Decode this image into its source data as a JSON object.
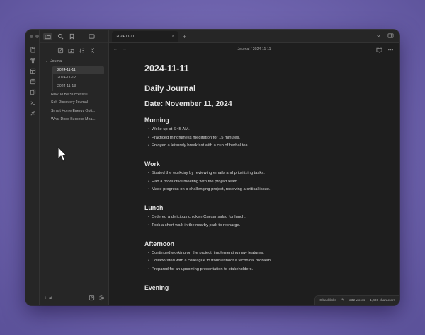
{
  "app": {
    "ribbon_icons": [
      "files-icon",
      "graph-icon",
      "canvas-icon",
      "calendar-icon",
      "templates-icon",
      "terminal-icon",
      "publish-icon"
    ],
    "sidebar_top_icons": [
      "folder-icon",
      "search-icon",
      "bookmark-icon"
    ],
    "sidebar_actions": [
      "new-note-icon",
      "new-folder-icon",
      "sort-icon",
      "collapse-icon"
    ]
  },
  "tabs": [
    {
      "label": "2024-11-11"
    }
  ],
  "breadcrumb": {
    "text": "Journal / 2024-11-11"
  },
  "sidebar": {
    "folder": {
      "label": "Journal"
    },
    "folder_children": [
      {
        "label": "2024-11-11",
        "selected": true
      },
      {
        "label": "2024-11-12",
        "selected": false
      },
      {
        "label": "2024-11-13",
        "selected": false
      }
    ],
    "files": [
      {
        "label": "How To Be Successful"
      },
      {
        "label": "Self-Discovery Journal"
      },
      {
        "label": "Smart Home Energy Opti..."
      },
      {
        "label": "What Does Success Mea..."
      }
    ],
    "vault_name": "ai"
  },
  "note": {
    "title": "2024-11-11",
    "h2": "Daily Journal",
    "h3": "Date: November 11, 2024",
    "sections": [
      {
        "heading": "Morning",
        "items": [
          "Woke up at 6:45 AM.",
          "Practiced mindfulness meditation for 15 minutes.",
          "Enjoyed a leisurely breakfast with a cup of herbal tea."
        ]
      },
      {
        "heading": "Work",
        "items": [
          "Started the workday by reviewing emails and prioritizing tasks.",
          "Had a productive meeting with the project team.",
          "Made progress on a challenging project, resolving a critical issue."
        ]
      },
      {
        "heading": "Lunch",
        "items": [
          "Ordered a delicious chicken Caesar salad for lunch.",
          "Took a short walk in the nearby park to recharge."
        ]
      },
      {
        "heading": "Afternoon",
        "items": [
          "Continued working on the project, implementing new features.",
          "Collaborated with a colleague to troubleshoot a technical problem.",
          "Prepared for an upcoming presentation to stakeholders."
        ]
      },
      {
        "heading": "Evening",
        "items": []
      }
    ]
  },
  "status": {
    "backlinks": "0 backlinks",
    "words": "232 words",
    "characters": "1,436 characters"
  }
}
